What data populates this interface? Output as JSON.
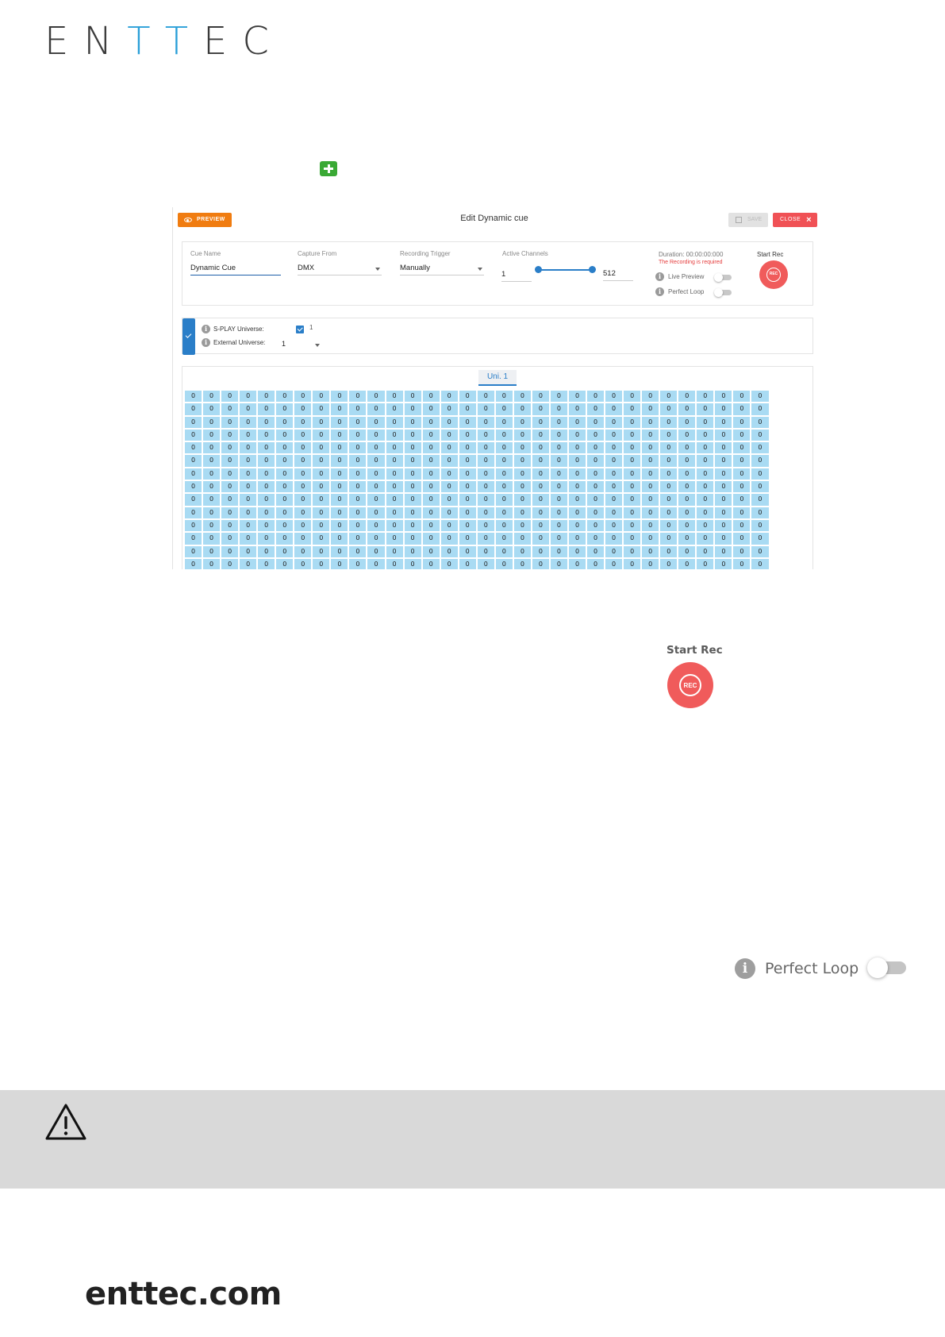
{
  "brand": {
    "logo_pre": "EN",
    "logo_mid": "TT",
    "logo_post": "EC"
  },
  "app": {
    "title": "Edit Dynamic cue",
    "preview_label": "PREVIEW",
    "save_label": "SAVE",
    "close_label": "CLOSE",
    "fields": {
      "cue_name": {
        "label": "Cue Name",
        "value": "Dynamic Cue"
      },
      "capture_from": {
        "label": "Capture From",
        "value": "DMX"
      },
      "recording_trigger": {
        "label": "Recording Trigger",
        "value": "Manually"
      },
      "active_channels": {
        "label": "Active Channels",
        "from": "1",
        "to": "512"
      }
    },
    "duration": "Duration: 00:00:00:000",
    "recording_required": "The Recording is required",
    "live_preview_label": "Live Preview",
    "perfect_loop_label": "Perfect Loop",
    "start_rec_label": "Start Rec",
    "rec_label": "REC",
    "splay_universe_label": "S-PLAY Universe:",
    "splay_universe_value": "1",
    "external_universe_label": "External Universe:",
    "external_universe_value": "1",
    "universe_tab": "Uni. 1",
    "dmx_value": "0",
    "dmx_rows": 14,
    "dmx_cols": 32
  },
  "zoom": {
    "start_rec_label": "Start Rec",
    "rec_label": "REC",
    "perfect_loop_label": "Perfect Loop"
  },
  "footer": {
    "website": "enttec.com"
  },
  "colors": {
    "accent_blue": "#2a9fd8",
    "rec_red": "#f05b5b",
    "preview_orange": "#f07c10",
    "close_red": "#f05155",
    "dmx_cell": "#a9dbf3"
  }
}
